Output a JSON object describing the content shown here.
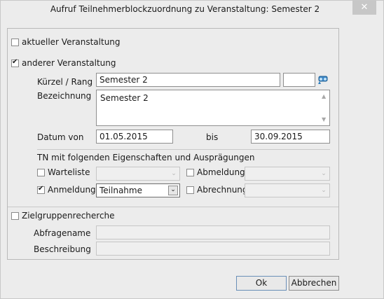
{
  "window": {
    "title": "Aufruf Teilnehmerblockzuordnung zu Veranstaltung: Semester 2",
    "close_glyph": "✕"
  },
  "options": {
    "current": {
      "label": "aktueller Veranstaltung",
      "checked": false
    },
    "other": {
      "label": "anderer Veranstaltung",
      "checked": true
    }
  },
  "event": {
    "kuerzel_label": "Kürzel / Rang",
    "kuerzel_value": "Semester 2",
    "rang_value": "",
    "search_icon": "search-binoculars-icon",
    "bezeichnung_label": "Bezeichnung",
    "bezeichnung_value": "Semester 2",
    "datum_von_label": "Datum von",
    "datum_von_value": "01.05.2015",
    "bis_label": "bis",
    "bis_value": "30.09.2015"
  },
  "tn": {
    "heading": "TN mit folgenden Eigenschaften und Ausprägungen",
    "warteliste": {
      "label": "Warteliste",
      "checked": false,
      "value": ""
    },
    "abmeldung": {
      "label": "Abmeldung",
      "checked": false,
      "value": ""
    },
    "anmeldung": {
      "label": "Anmeldung",
      "checked": true,
      "value": "Teilnahme"
    },
    "abrechnung": {
      "label": "Abrechnung",
      "checked": false,
      "value": ""
    }
  },
  "zielgruppe": {
    "label": "Zielgruppenrecherche",
    "checked": false,
    "abfragename_label": "Abfragename",
    "abfragename_value": "",
    "beschreibung_label": "Beschreibung",
    "beschreibung_value": ""
  },
  "buttons": {
    "ok": "Ok",
    "cancel": "Abbrechen"
  },
  "colors": {
    "window_bg": "#ececec",
    "accent_icon": "#2f7fbf"
  }
}
